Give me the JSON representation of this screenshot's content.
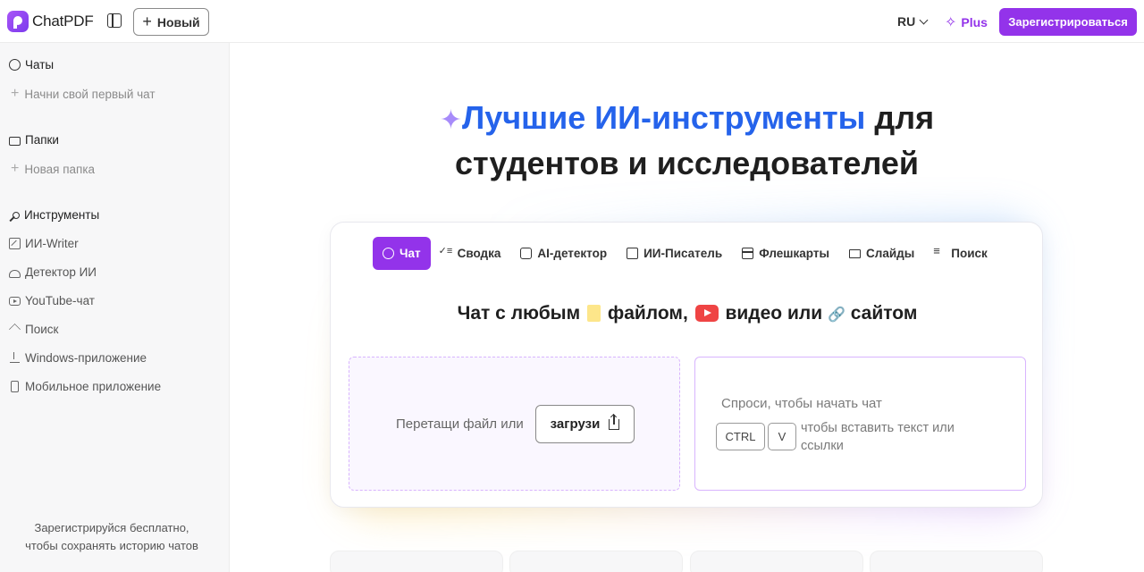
{
  "header": {
    "app_name": "ChatPDF",
    "new_label": "Новый",
    "lang": "RU",
    "plus_label": "Plus",
    "signup_label": "Зарегистрироваться"
  },
  "sidebar": {
    "chats_label": "Чаты",
    "chats_sub": "Начни свой первый чат",
    "folders_label": "Папки",
    "folders_sub": "Новая папка",
    "tools_label": "Инструменты",
    "tools": [
      {
        "label": "ИИ-Writer",
        "icon": "pen-icon"
      },
      {
        "label": "Детектор ИИ",
        "icon": "detector-icon"
      },
      {
        "label": "YouTube-чат",
        "icon": "youtube-icon"
      },
      {
        "label": "Поиск",
        "icon": "cap-icon"
      },
      {
        "label": "Windows-приложение",
        "icon": "download-icon"
      },
      {
        "label": "Мобильное приложение",
        "icon": "phone-icon"
      }
    ],
    "footer": "Зарегистрируйся бесплатно, чтобы сохранять историю чатов"
  },
  "hero": {
    "accent": "Лучшие ИИ-инструменты",
    "line1_rest": " для",
    "line2": "студентов и исследователей"
  },
  "tabs": [
    {
      "label": "Чат",
      "active": true,
      "icon": "chat-icon"
    },
    {
      "label": "Сводка",
      "active": false,
      "icon": "checklist-icon"
    },
    {
      "label": "AI-детектор",
      "active": false,
      "icon": "detector-icon"
    },
    {
      "label": "ИИ-Писатель",
      "active": false,
      "icon": "pen-icon"
    },
    {
      "label": "Флешкарты",
      "active": false,
      "icon": "flashcard-icon"
    },
    {
      "label": "Слайды",
      "active": false,
      "icon": "slides-icon"
    },
    {
      "label": "Поиск",
      "active": false,
      "icon": "search-list-icon"
    }
  ],
  "chat_panel": {
    "title_part1": "Чат с любым",
    "title_part2": "файлом,",
    "title_part3": "видео или",
    "title_part4": "сайтом",
    "drop_text": "Перетащи файл или",
    "upload_label": "загрузи",
    "ask_placeholder": "Спроси, чтобы начать чат",
    "kbd_ctrl": "CTRL",
    "kbd_v": "V",
    "paste_hint": "чтобы вставить текст или ссылки"
  },
  "colors": {
    "accent_purple": "#9333ea",
    "hero_blue": "#2563eb"
  }
}
